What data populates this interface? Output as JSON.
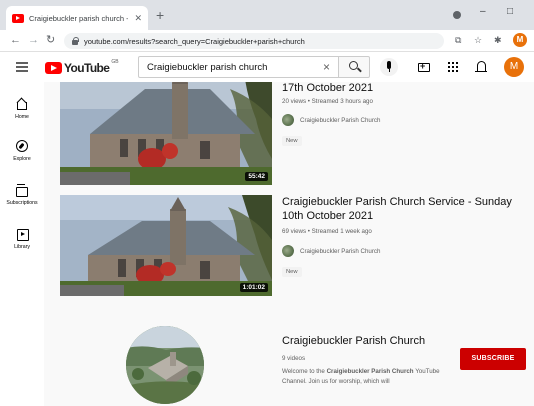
{
  "browser": {
    "tab_title": "Craigiebuckler parish church - Yo",
    "new_tab": "+",
    "close_tab": "✕",
    "url": "youtube.com/results?search_query=Craigiebuckler+parish+church",
    "minimize": "–",
    "maximize": "□",
    "profile_initial": "M"
  },
  "header": {
    "logo_text": "YouTube",
    "logo_country": "GB",
    "search_value": "Craigiebuckler parish church",
    "avatar_initial": "M"
  },
  "guide": {
    "items": [
      {
        "label": "Home",
        "icon": "home-icon"
      },
      {
        "label": "Explore",
        "icon": "explore-icon"
      },
      {
        "label": "Subscriptions",
        "icon": "subscriptions-icon"
      },
      {
        "label": "Library",
        "icon": "library-icon"
      }
    ]
  },
  "results": [
    {
      "title": "17th October 2021",
      "meta": "20 views • Streamed 3 hours ago",
      "channel": "Craigiebuckler Parish Church",
      "badge": "New",
      "duration": "55:42"
    },
    {
      "title": "Craigiebuckler Parish Church Service - Sunday 10th October 2021",
      "meta": "69 views • Streamed 1 week ago",
      "channel": "Craigiebuckler Parish Church",
      "badge": "New",
      "duration": "1:01:02"
    }
  ],
  "channel_result": {
    "name": "Craigiebuckler Parish Church",
    "videos": "9 videos",
    "desc_prefix": "Welcome to the ",
    "desc_bold": "Craigiebuckler Parish Church",
    "desc_suffix": " YouTube Channel. Join us for worship, which will",
    "subscribe_label": "SUBSCRIBE"
  },
  "colors": {
    "brand_red": "#ff0000",
    "subscribe_red": "#cc0000",
    "avatar_orange": "#e8710a"
  }
}
